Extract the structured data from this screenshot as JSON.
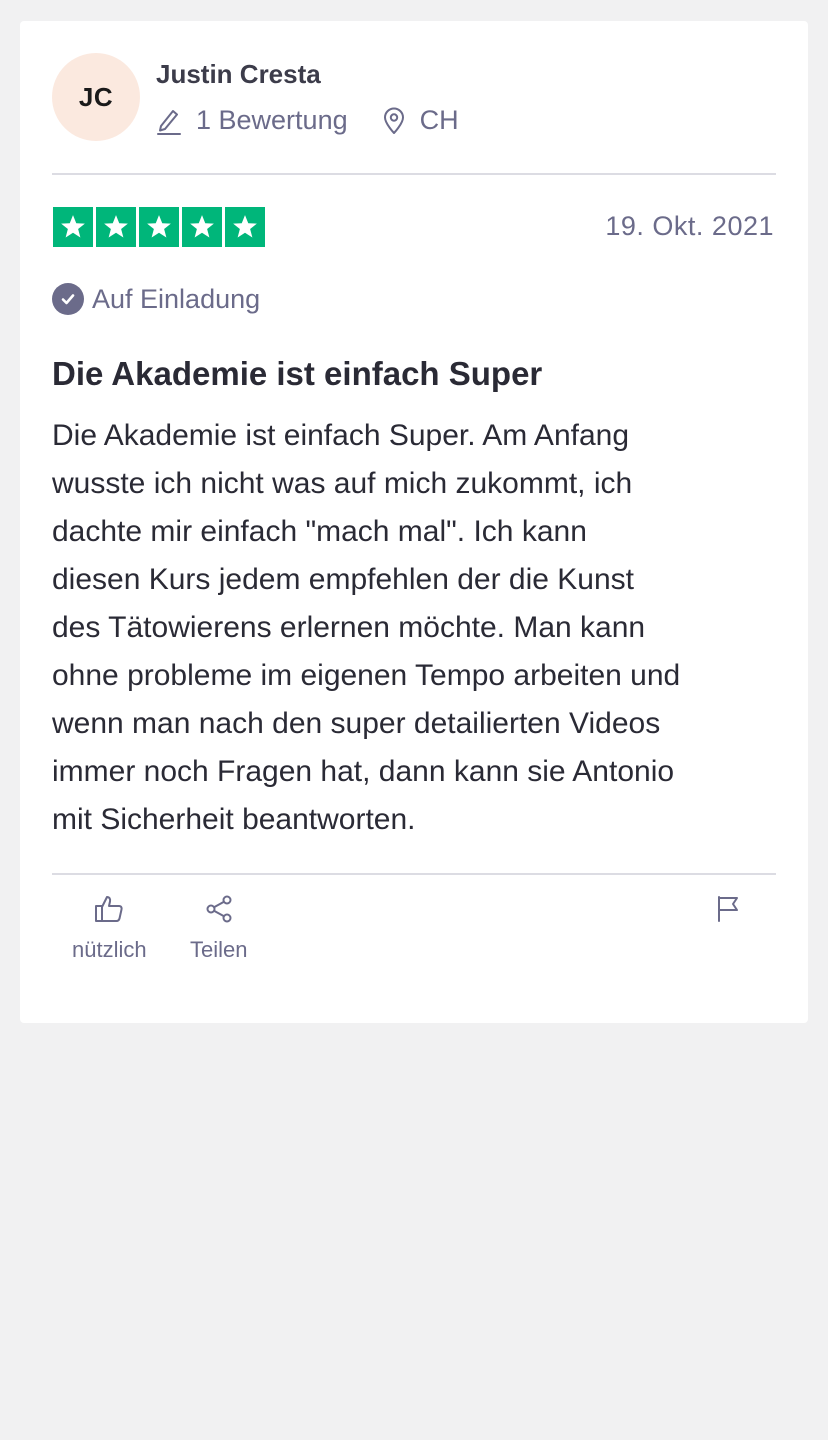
{
  "review": {
    "consumer": {
      "initials": "JC",
      "name": "Justin Cresta",
      "review_count": "1 Bewertung",
      "country": "CH"
    },
    "rating": 5,
    "date": "19. Okt. 2021",
    "verification_label": "Auf Einladung",
    "title": "Die Akademie ist einfach Super",
    "text": "Die Akademie ist einfach Super. Am Anfang\nwusste ich nicht was auf mich zukommt, ich\ndachte mir einfach \"mach mal\". Ich kann\ndiesen Kurs jedem empfehlen der die Kunst\ndes Tätowierens erlernen möchte. Man kann\nohne probleme im eigenen Tempo arbeiten und\nwenn man nach den super detailierten Videos\nimmer noch Fragen hat, dann kann sie Antonio\nmit Sicherheit beantworten."
  },
  "actions": {
    "useful_label": "nützlich",
    "share_label": "Teilen",
    "report_icon": "flag-icon"
  },
  "colors": {
    "star_green": "#00b67a",
    "muted_text": "#6b6b8a",
    "avatar_bg": "#fbe9df",
    "page_bg": "#f1f1f2"
  }
}
